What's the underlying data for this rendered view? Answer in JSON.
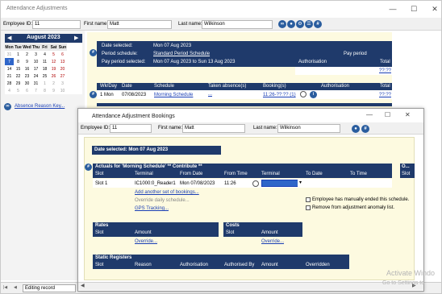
{
  "window": {
    "title": "Attendance Adjustments",
    "minimize": "—",
    "maximize": "☐",
    "close": "✕"
  },
  "header": {
    "employee_id_label": "Employee ID:",
    "employee_id_value": "11",
    "first_name_label": "First name:",
    "first_name_value": "Matt",
    "last_name_label": "Last name:",
    "last_name_value": "Wilkinson"
  },
  "calendar": {
    "month_label": "August 2023",
    "prev": "◀",
    "next": "▶",
    "weekdays": [
      "Mon",
      "Tue",
      "Wed",
      "Thu",
      "Fri",
      "Sat",
      "Sun"
    ],
    "weeks": [
      [
        "31",
        "1",
        "2",
        "3",
        "4",
        "5",
        "6"
      ],
      [
        "7",
        "8",
        "9",
        "10",
        "11",
        "12",
        "13"
      ],
      [
        "14",
        "15",
        "16",
        "17",
        "18",
        "19",
        "20"
      ],
      [
        "21",
        "22",
        "23",
        "24",
        "25",
        "26",
        "27"
      ],
      [
        "28",
        "29",
        "30",
        "31",
        "1",
        "2",
        "3"
      ],
      [
        "4",
        "5",
        "6",
        "7",
        "8",
        "9",
        "10"
      ]
    ],
    "selected": "7"
  },
  "absence_link": "Absence Reason Key...",
  "summary": {
    "date_selected_label": "Date selected:",
    "date_selected_value": "Mon 07 Aug 2023",
    "period_schedule_label": "Period schedule:",
    "period_schedule_value": "Standard Period Schedule",
    "pay_period_selected_label": "Pay period selected:",
    "pay_period_selected_value": "Mon 07 Aug 2023 to Sun 13 Aug 2023",
    "pay_period_header": "Pay period",
    "authorisation_header": "Authorisation",
    "total_header": "Total",
    "total_value": "??:??"
  },
  "schedule_table": {
    "headers": [
      "Wk/Day",
      "Date",
      "Schedule",
      "Taken absence(s)",
      "Booking(s)",
      "Authorisation",
      "Total"
    ],
    "row": {
      "wkday": "1 Mon",
      "date": "07/08/2023",
      "schedule": "Morning Schedule",
      "absence": "...",
      "bookings": "11:26-??:?? (1)",
      "total": "??:??"
    }
  },
  "status": {
    "text": "Editing record",
    "nav_first": "|◀",
    "nav_prev": "◀"
  },
  "dialog": {
    "title": "Attendance Adjustment Bookings",
    "minimize": "—",
    "maximize": "☐",
    "close": "✕",
    "employee_id_label": "Employee ID:",
    "employee_id_value": "11",
    "first_name_label": "First name:",
    "first_name_value": "Matt",
    "last_name_label": "Last name:",
    "last_name_value": "Wilkinson",
    "date_selected": "Date selected: Mon 07 Aug 2023",
    "actuals_title": "Actuals for 'Morning Schedule' ** Contribute **",
    "actuals_headers": [
      "Slot",
      "Terminal",
      "From Date",
      "From Time",
      "Terminal",
      "To Date",
      "To Time"
    ],
    "actuals_row": {
      "slot": "Slot 1",
      "terminal": "IC1000:0_Reader1",
      "from_date": "Mon 07/08/2023",
      "from_time": "11:26"
    },
    "add_link": "Add another set of bookings...",
    "override_daily": "Override daily schedule...",
    "gps_link": "GPS Tracking...",
    "check_manual": "Employee has manually ended this schedule.",
    "check_anomaly": "Remove from adjustment anomaly list.",
    "right_header": "O...",
    "right_slot": "Slot",
    "rates_title": "Rates",
    "rates_headers": [
      "Slot",
      "Amount"
    ],
    "rates_override": "Override...",
    "costs_title": "Costs",
    "costs_headers": [
      "Slot",
      "Amount"
    ],
    "costs_override": "Override...",
    "static_title": "Static Registers",
    "static_headers": [
      "Slot",
      "Reason",
      "Authorisation",
      "Authorised By",
      "Amount",
      "Overridden"
    ]
  },
  "watermark": {
    "line1": "Activate Windo",
    "line2": "Go to Settings to"
  }
}
